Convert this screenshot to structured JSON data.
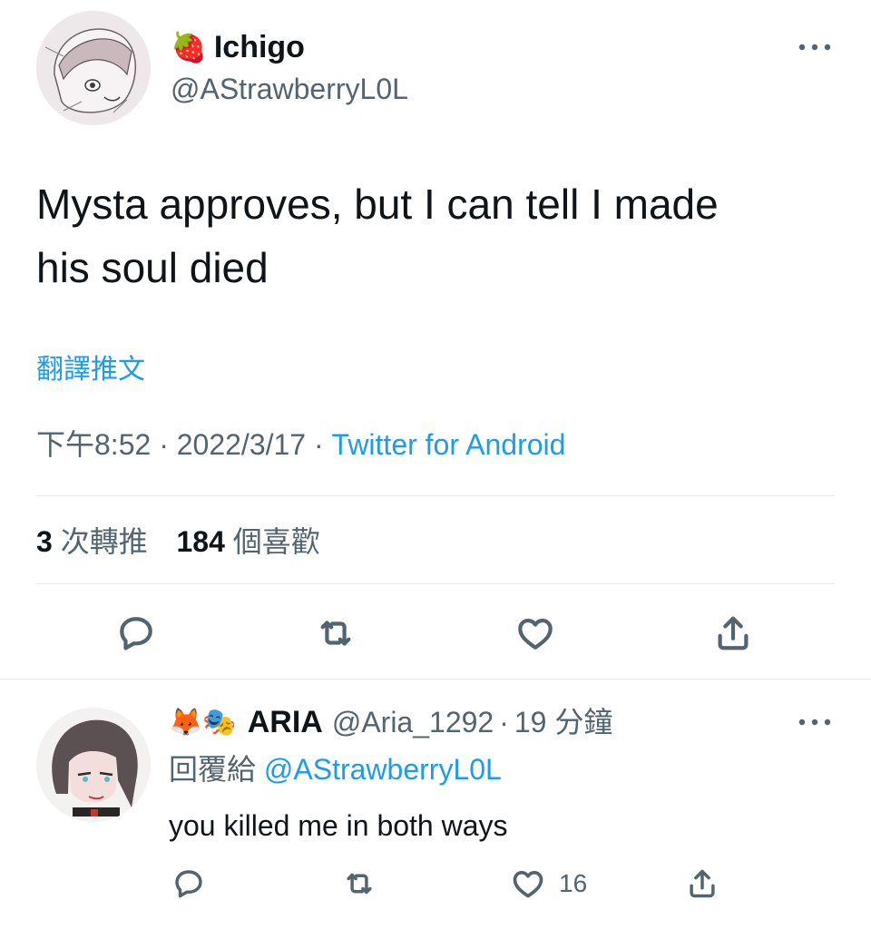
{
  "tweet": {
    "author": {
      "emoji": "🍓",
      "name": "Ichigo",
      "handle": "@AStrawberryL0L"
    },
    "more_icon": "more-horizontal-icon",
    "text_line1": "Mysta approves, but I can tell I made",
    "text_line2": "his soul died",
    "translate_label": "翻譯推文",
    "time": "下午8:52",
    "sep1": "·",
    "date": "2022/3/17",
    "sep2": "·",
    "source": "Twitter for Android",
    "retweet_count": "3",
    "retweet_label": "次轉推",
    "like_count": "184",
    "like_label": "個喜歡",
    "actions": [
      "reply-icon",
      "retweet-icon",
      "like-icon",
      "share-icon"
    ]
  },
  "reply": {
    "author": {
      "emojis": "🦊🎭",
      "name": "ARIA",
      "handle": "@Aria_1292",
      "sep": "·",
      "time": "19 分鐘"
    },
    "replying_label": "回覆給",
    "replying_to": "@AStrawberryL0L",
    "text": "you killed me in both ways",
    "like_count": "16",
    "actions": [
      "reply-icon",
      "retweet-icon",
      "like-icon",
      "share-icon"
    ]
  },
  "colors": {
    "accent": "#1d9bf0",
    "secondary_text": "#536471",
    "primary_text": "#0f1419",
    "divider": "#e6e9eb"
  }
}
